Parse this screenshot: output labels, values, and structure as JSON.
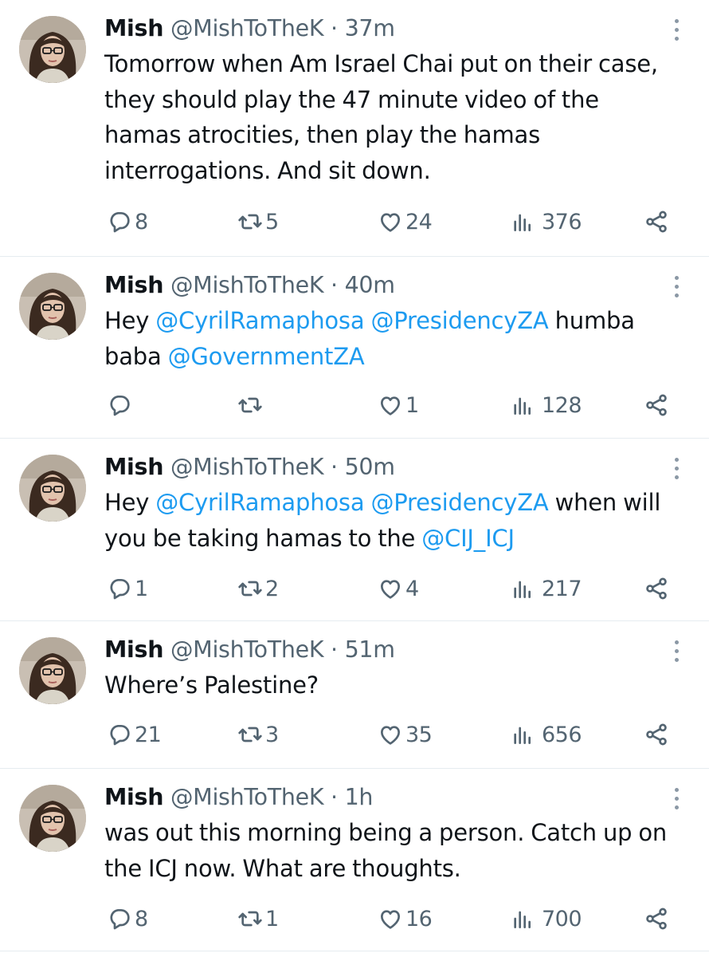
{
  "tweets": [
    {
      "name": "Mish",
      "handle": "@MishToTheK",
      "separator": "·",
      "time": "37m",
      "segments": [
        {
          "text": "Tomorrow when Am Israel Chai put on their case, they should play the 47 minute video of the hamas atrocities, then play the hamas interrogations. And sit down.",
          "mention": false
        }
      ],
      "replies": "8",
      "retweets": "5",
      "likes": "24",
      "views": "376"
    },
    {
      "name": "Mish",
      "handle": "@MishToTheK",
      "separator": "·",
      "time": "40m",
      "segments": [
        {
          "text": "Hey ",
          "mention": false
        },
        {
          "text": "@CyrilRamaphosa",
          "mention": true
        },
        {
          "text": " ",
          "mention": false
        },
        {
          "text": "@PresidencyZA",
          "mention": true
        },
        {
          "text": " humba baba ",
          "mention": false
        },
        {
          "text": "@GovernmentZA",
          "mention": true
        }
      ],
      "replies": "",
      "retweets": "",
      "likes": "1",
      "views": "128"
    },
    {
      "name": "Mish",
      "handle": "@MishToTheK",
      "separator": "·",
      "time": "50m",
      "segments": [
        {
          "text": "Hey ",
          "mention": false
        },
        {
          "text": "@CyrilRamaphosa",
          "mention": true
        },
        {
          "text": " ",
          "mention": false
        },
        {
          "text": "@PresidencyZA",
          "mention": true
        },
        {
          "text": " when will you be taking hamas to the ",
          "mention": false
        },
        {
          "text": "@CIJ_ICJ",
          "mention": true
        }
      ],
      "replies": "1",
      "retweets": "2",
      "likes": "4",
      "views": "217"
    },
    {
      "name": "Mish",
      "handle": "@MishToTheK",
      "separator": "·",
      "time": "51m",
      "segments": [
        {
          "text": "Where’s Palestine?",
          "mention": false
        }
      ],
      "replies": "21",
      "retweets": "3",
      "likes": "35",
      "views": "656"
    },
    {
      "name": "Mish",
      "handle": "@MishToTheK",
      "separator": "·",
      "time": "1h",
      "segments": [
        {
          "text": "was out this morning being a person. Catch up on the ICJ now. What are thoughts.",
          "mention": false
        }
      ],
      "replies": "8",
      "retweets": "1",
      "likes": "16",
      "views": "700"
    }
  ],
  "icons": {
    "reply": "reply-icon",
    "retweet": "retweet-icon",
    "like": "heart-icon",
    "views": "views-icon",
    "share": "share-icon",
    "more": "more-options-icon"
  },
  "colors": {
    "text": "#0f1419",
    "secondary": "#536471",
    "mention": "#1d9bf0",
    "divider": "#e6ecf0"
  }
}
